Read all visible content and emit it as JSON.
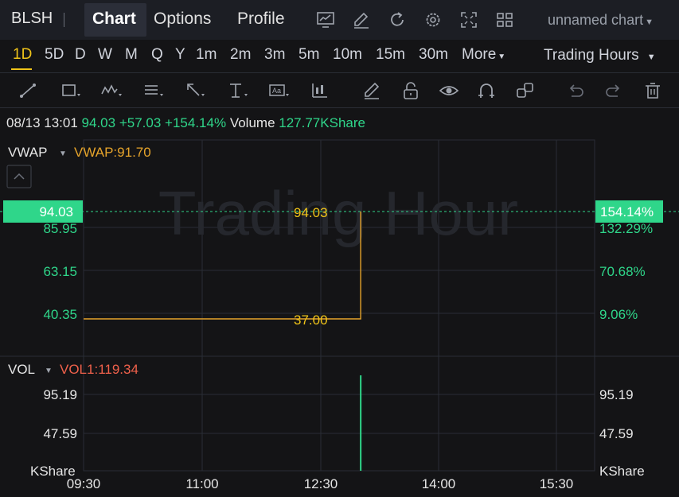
{
  "topbar": {
    "ticker": "BLSH",
    "tabs": [
      "Chart",
      "Options",
      "Profile"
    ],
    "active_tab": "Chart",
    "chart_name": "unnamed chart",
    "icons": [
      "trend-chart-icon",
      "edit-icon",
      "refresh-icon",
      "settings-icon",
      "fullscreen-icon",
      "layout-grid-icon"
    ]
  },
  "intervals": {
    "items": [
      "1D",
      "5D",
      "D",
      "W",
      "M",
      "Q",
      "Y",
      "1m",
      "2m",
      "3m",
      "5m",
      "10m",
      "15m",
      "30m"
    ],
    "active": "1D",
    "more": "More",
    "session": "Trading Hours"
  },
  "toolbar": {
    "tools": [
      "trendline-tool",
      "rectangle-tool",
      "pattern-tool",
      "fibonacci-tool",
      "arrow-tool",
      "measure-tool",
      "text-tool",
      "indicator-tool",
      "pencil-tool",
      "lock-tool",
      "visibility-tool",
      "magnet-tool",
      "clone-tool",
      "undo-tool",
      "redo-tool",
      "delete-tool"
    ]
  },
  "info": {
    "datetime": "08/13 13:01",
    "price": "94.03",
    "change": "+57.03",
    "change_pct": "+154.14%",
    "volume_label": "Volume",
    "volume": "127.77KShare"
  },
  "main_panel": {
    "indicator_name": "VWAP",
    "indicator_value": "VWAP:91.70",
    "watermark": "Trading Hour",
    "price_labels": [
      "85.95",
      "63.15",
      "40.35"
    ],
    "pct_labels": [
      "132.29%",
      "70.68%",
      "9.06%"
    ],
    "current_price_tag": "94.03",
    "current_pct_tag": "154.14%",
    "annotation_high": "94.03",
    "annotation_low": "37.00"
  },
  "volume_panel": {
    "indicator_name": "VOL",
    "indicator_value": "VOL1:119.34",
    "labels": [
      "95.19",
      "47.59"
    ],
    "unit": "KShare"
  },
  "x_axis": [
    "09:30",
    "11:00",
    "12:30",
    "14:00",
    "15:30"
  ],
  "colors": {
    "up": "#2fd68a",
    "price_line": "#e6a42b",
    "accent": "#f0c419",
    "vol_indicator": "#f0614b",
    "vwap_label": "#e6a42b"
  },
  "chart_data": [
    {
      "type": "line",
      "series": [
        {
          "name": "VWAP",
          "x": [
            "09:30",
            "13:00",
            "13:01"
          ],
          "y": [
            37.0,
            37.0,
            94.03
          ]
        }
      ],
      "ylim": [
        30,
        100
      ],
      "xlabel": "",
      "ylabel": ""
    },
    {
      "type": "bar",
      "series": [
        {
          "name": "VOL",
          "x": [
            "13:01"
          ],
          "y": [
            127.77
          ]
        }
      ],
      "ylim": [
        0,
        130
      ]
    }
  ]
}
